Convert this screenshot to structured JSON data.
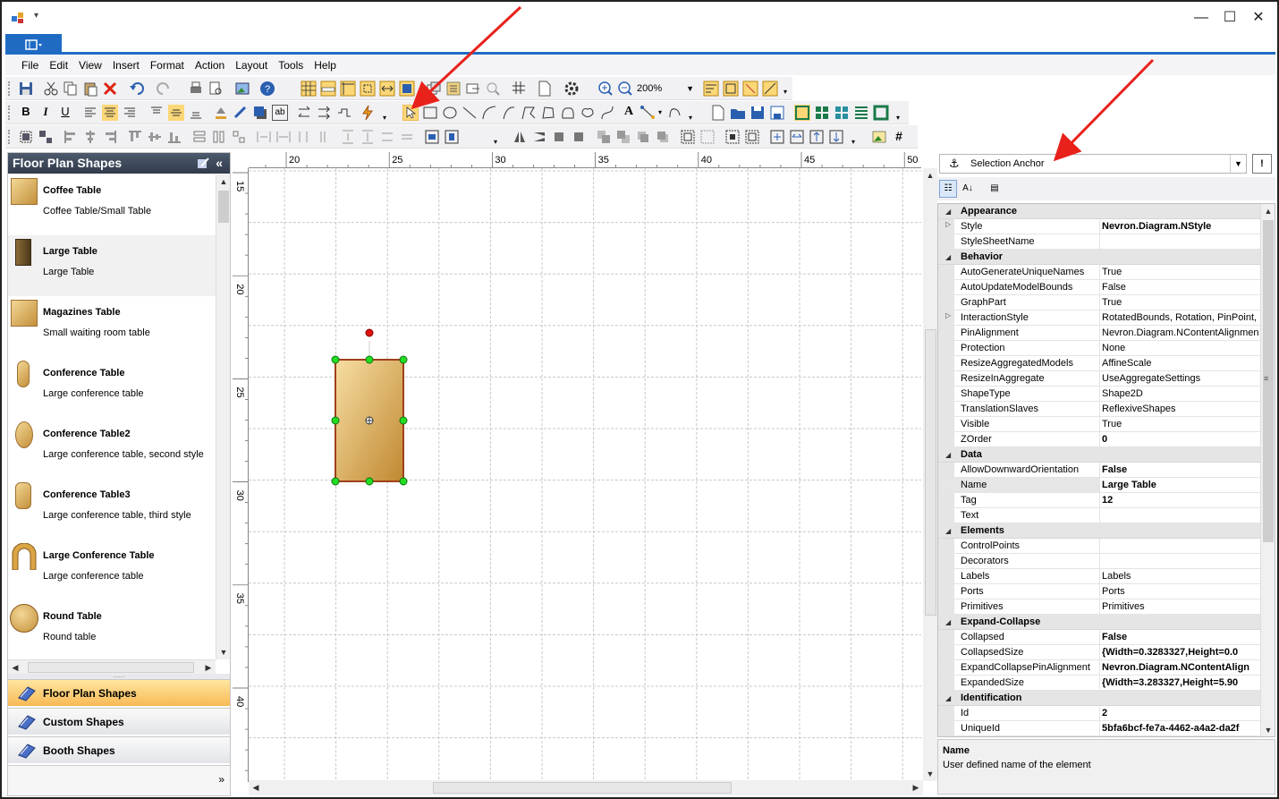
{
  "menu": [
    "File",
    "Edit",
    "View",
    "Insert",
    "Format",
    "Action",
    "Layout",
    "Tools",
    "Help"
  ],
  "toolbar": {
    "zoom": "200%"
  },
  "left_panel": {
    "title": "Floor Plan Shapes",
    "shapes": [
      {
        "name": "Coffee Table",
        "desc": "Coffee Table/Small Table"
      },
      {
        "name": "Large Table",
        "desc": "Large Table"
      },
      {
        "name": "Magazines Table",
        "desc": "Small waiting room table"
      },
      {
        "name": "Conference Table",
        "desc": "Large conference table"
      },
      {
        "name": "Conference Table2",
        "desc": "Large conference table, second style"
      },
      {
        "name": "Conference Table3",
        "desc": "Large conference table, third style"
      },
      {
        "name": "Large Conference Table",
        "desc": "Large conference table"
      },
      {
        "name": "Round Table",
        "desc": "Round table"
      }
    ],
    "tabs": [
      "Floor Plan Shapes",
      "Custom Shapes",
      "Booth Shapes"
    ]
  },
  "ruler": {
    "h_labels": [
      "20",
      "25",
      "30",
      "35",
      "40",
      "45",
      "50"
    ],
    "v_labels": [
      "15",
      "20",
      "25",
      "30",
      "35",
      "40"
    ]
  },
  "properties": {
    "selected_object": "Selection Anchor",
    "categories": [
      {
        "name": "Appearance",
        "rows": [
          {
            "k": "Style",
            "v": "Nevron.Diagram.NStyle",
            "bold": true,
            "expand": true
          },
          {
            "k": "StyleSheetName",
            "v": ""
          }
        ]
      },
      {
        "name": "Behavior",
        "rows": [
          {
            "k": "AutoGenerateUniqueNames",
            "v": "True"
          },
          {
            "k": "AutoUpdateModelBounds",
            "v": "False"
          },
          {
            "k": "GraphPart",
            "v": "True"
          },
          {
            "k": "InteractionStyle",
            "v": "RotatedBounds, Rotation, PinPoint, S",
            "expand": true
          },
          {
            "k": "PinAlignment",
            "v": "Nevron.Diagram.NContentAlignment"
          },
          {
            "k": "Protection",
            "v": "None"
          },
          {
            "k": "ResizeAggregatedModels",
            "v": "AffineScale"
          },
          {
            "k": "ResizeInAggregate",
            "v": "UseAggregateSettings"
          },
          {
            "k": "ShapeType",
            "v": "Shape2D"
          },
          {
            "k": "TranslationSlaves",
            "v": "ReflexiveShapes"
          },
          {
            "k": "Visible",
            "v": "True"
          },
          {
            "k": "ZOrder",
            "v": "0",
            "bold": true
          }
        ]
      },
      {
        "name": "Data",
        "rows": [
          {
            "k": "AllowDownwardOrientation",
            "v": "False",
            "bold": true
          },
          {
            "k": "Name",
            "v": "Large Table",
            "bold": true,
            "selected": true
          },
          {
            "k": "Tag",
            "v": "12",
            "bold": true
          },
          {
            "k": "Text",
            "v": ""
          }
        ]
      },
      {
        "name": "Elements",
        "rows": [
          {
            "k": "ControlPoints",
            "v": ""
          },
          {
            "k": "Decorators",
            "v": ""
          },
          {
            "k": "Labels",
            "v": "Labels"
          },
          {
            "k": "Ports",
            "v": "Ports"
          },
          {
            "k": "Primitives",
            "v": "Primitives"
          }
        ]
      },
      {
        "name": "Expand-Collapse",
        "rows": [
          {
            "k": "Collapsed",
            "v": "False",
            "bold": true
          },
          {
            "k": "CollapsedSize",
            "v": "{Width=0.3283327,Height=0.0",
            "bold": true
          },
          {
            "k": "ExpandCollapsePinAlignment",
            "v": "Nevron.Diagram.NContentAlign",
            "bold": true
          },
          {
            "k": "ExpandedSize",
            "v": "{Width=3.283327,Height=5.90",
            "bold": true
          }
        ]
      },
      {
        "name": "Identification",
        "rows": [
          {
            "k": "Id",
            "v": "2",
            "bold": true
          },
          {
            "k": "UniqueId",
            "v": "5bfa6bcf-fe7a-4462-a4a2-da2f",
            "bold": true
          }
        ]
      }
    ],
    "description": {
      "title": "Name",
      "text": "User defined name of the element"
    }
  },
  "colors": {
    "accent": "#1f6bc4",
    "table_fill": "#d9a545",
    "table_border": "#a0401c",
    "handle": "#22cc22",
    "rotate_handle": "#dd1111",
    "arrow": "#e8211b"
  }
}
